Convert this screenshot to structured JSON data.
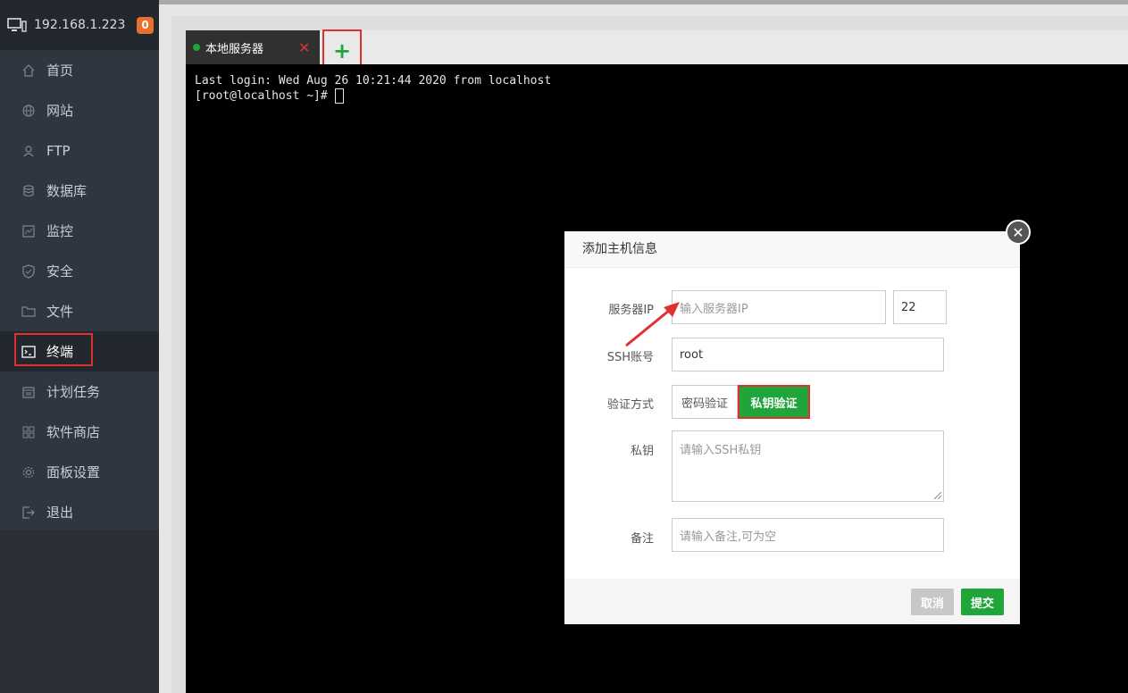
{
  "sidebar": {
    "host_ip": "192.168.1.223",
    "badge_count": "0",
    "items": [
      {
        "label": "首页",
        "icon": "home-icon"
      },
      {
        "label": "网站",
        "icon": "globe-icon"
      },
      {
        "label": "FTP",
        "icon": "ftp-user-icon"
      },
      {
        "label": "数据库",
        "icon": "database-icon"
      },
      {
        "label": "监控",
        "icon": "monitor-chart-icon"
      },
      {
        "label": "安全",
        "icon": "shield-icon"
      },
      {
        "label": "文件",
        "icon": "folder-icon"
      },
      {
        "label": "终端",
        "icon": "terminal-icon",
        "active": true
      },
      {
        "label": "计划任务",
        "icon": "calendar-icon"
      },
      {
        "label": "软件商店",
        "icon": "grid-icon"
      },
      {
        "label": "面板设置",
        "icon": "gear-icon"
      },
      {
        "label": "退出",
        "icon": "logout-icon"
      }
    ]
  },
  "tabs": {
    "current_label": "本地服务器",
    "close_symbol": "✕",
    "add_symbol": "+"
  },
  "terminal": {
    "line1": "Last login: Wed Aug 26 10:21:44 2020 from localhost",
    "prompt": "[root@localhost ~]# "
  },
  "modal": {
    "title": "添加主机信息",
    "server_ip_label": "服务器IP",
    "server_ip_placeholder": "输入服务器IP",
    "port_value": "22",
    "ssh_account_label": "SSH账号",
    "ssh_account_value": "root",
    "auth_label": "验证方式",
    "auth_password": "密码验证",
    "auth_key": "私钥验证",
    "private_key_label": "私钥",
    "private_key_placeholder": "请输入SSH私钥",
    "remark_label": "备注",
    "remark_placeholder": "请输入备注,可为空",
    "cancel_label": "取消",
    "submit_label": "提交"
  },
  "colors": {
    "accent": "#20a53a",
    "highlight": "#e03131",
    "sidebar_bg": "#30363f"
  }
}
